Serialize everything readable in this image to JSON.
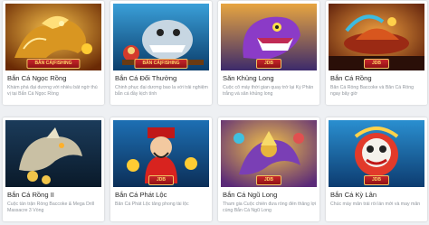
{
  "games": [
    {
      "title": "Bắn Cá Ngọc Rồng",
      "desc": "Khám phá đại dương với nhiều bất ngờ thú vị tại Bắn Cá Ngọc Rồng",
      "badge": "BẮN CÁ|FISHING",
      "icon": "golden-dragon-illustration"
    },
    {
      "title": "Bắn Cá Đổi Thưởng",
      "desc": "Chinh phục đại dương bao la với trải nghiệm bắn cá đầy kịch tính",
      "badge": "BẮN CÁ|FISHING",
      "icon": "shark-boss-illustration"
    },
    {
      "title": "Săn Khủng Long",
      "desc": "Cuộc cổ máy thời gian quay trở lại Kỷ Phấn trắng và săn khủng long",
      "badge": "JDB",
      "icon": "purple-dinosaur-illustration"
    },
    {
      "title": "Bắn Cá Rồng",
      "desc": "Bắn Cá Rồng Baccoke và Bắn Cá Rồng ngay bây giờ",
      "badge": "JDB",
      "icon": "dragon-ship-illustration"
    },
    {
      "title": "Bắn Cá Rồng II",
      "desc": "Cuộc tấn trận Rồng Baccoke & Mega Drill Massacre 3 Vòng",
      "badge": "",
      "icon": "silver-dragon-illustration"
    },
    {
      "title": "Bắn Cá Phát Lộc",
      "desc": "Bắn Cá Phát Lộc tăng phong tài lộc",
      "badge": "JDB",
      "icon": "fortune-god-illustration"
    },
    {
      "title": "Bắn Cá Ngũ Long",
      "desc": "Tham gia Cuộc chiến đưa rồng đến thắng lợi cùng Bắn Cá Ngũ Long",
      "badge": "JDB",
      "icon": "five-dragons-illustration"
    },
    {
      "title": "Bắn Cá Kỳ Lân",
      "desc": "Chúc mày mắn trái rồi lần mới và may mắn",
      "badge": "JDB",
      "icon": "lion-dance-illustration"
    }
  ],
  "colors": {
    "ribbon": "#c8262b",
    "title": "#2b2b2b",
    "desc": "#8f959c",
    "background": "#eef0f3"
  }
}
